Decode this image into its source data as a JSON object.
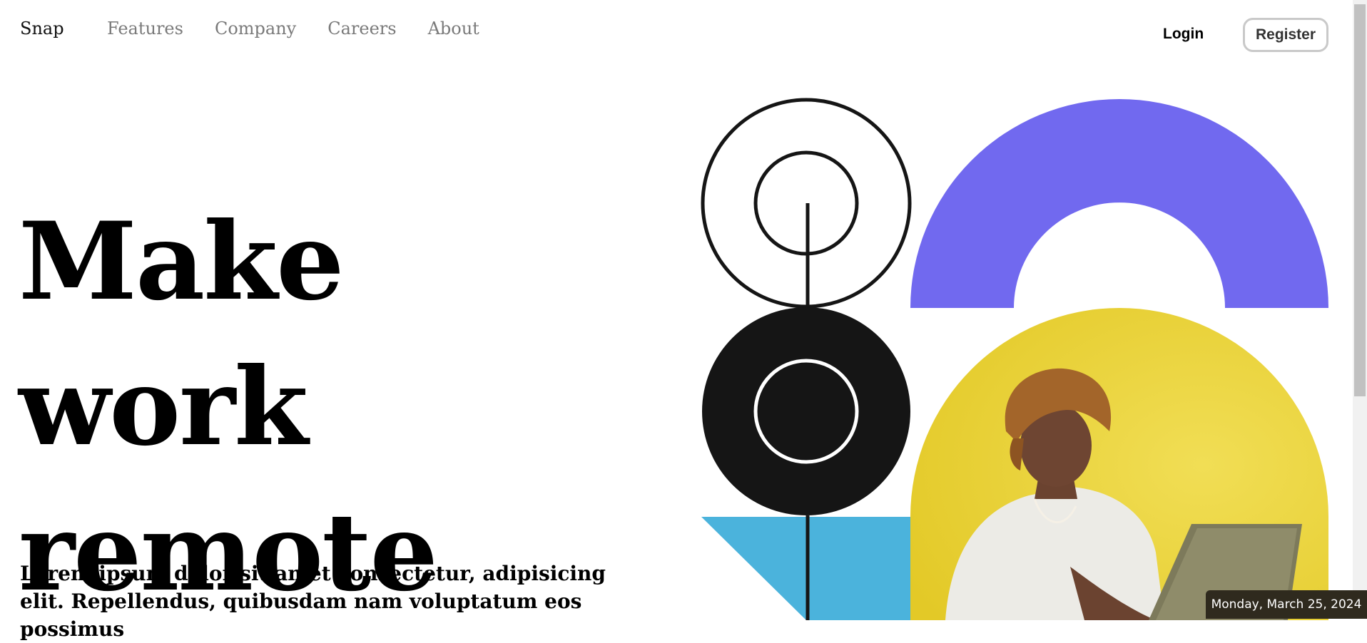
{
  "header": {
    "brand": "Snap",
    "nav": [
      {
        "label": "Features"
      },
      {
        "label": "Company"
      },
      {
        "label": "Careers"
      },
      {
        "label": "About"
      }
    ],
    "login_label": "Login",
    "register_label": "Register"
  },
  "hero": {
    "title_line1": "Make work",
    "title_line2": "remote",
    "lead": "Lorem ipsum dolor sit amet consectetur, adipisicing elit. Repellendus, quibusdam nam voluptatum eos possimus"
  },
  "illustration": {
    "colors": {
      "purple": "#7169ef",
      "yellow": "#e6cf2f",
      "blue": "#4bb3dc",
      "black": "#151515"
    },
    "photo_subject": "person-with-laptop"
  },
  "taskbar": {
    "date": "Monday, March 25, 2024"
  }
}
